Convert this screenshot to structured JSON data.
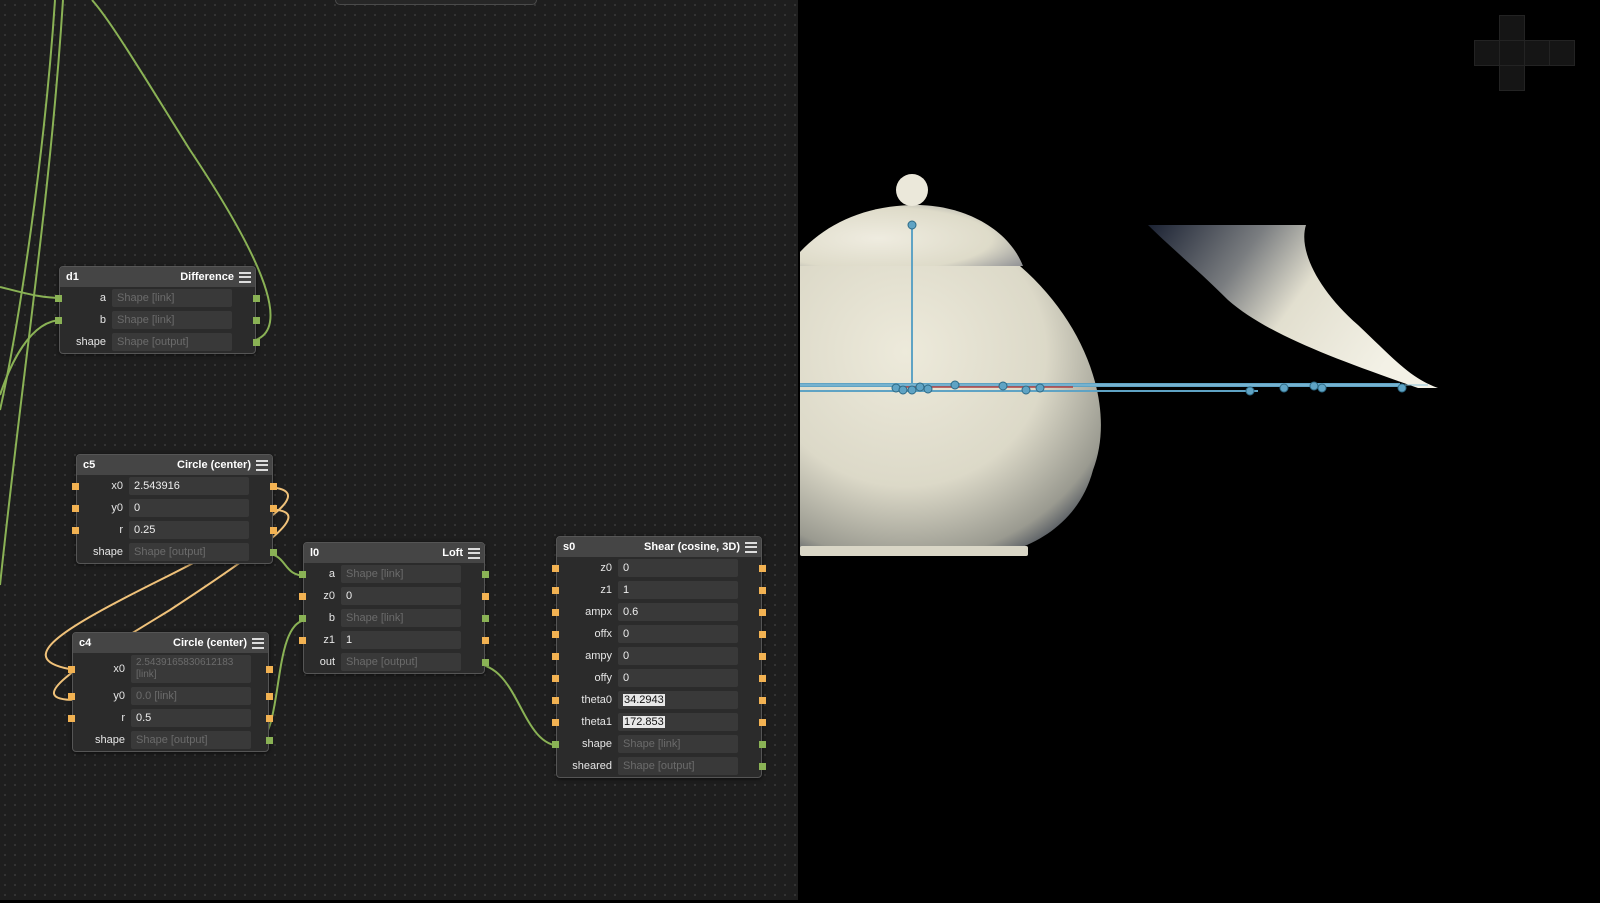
{
  "nodes": {
    "d1": {
      "name": "d1",
      "type": "Difference",
      "rows": [
        {
          "label": "a",
          "value": "Shape [link]"
        },
        {
          "label": "b",
          "value": "Shape [link]"
        },
        {
          "label": "shape",
          "value": "Shape [output]"
        }
      ]
    },
    "c5": {
      "name": "c5",
      "type": "Circle (center)",
      "rows": [
        {
          "label": "x0",
          "value": "2.543916"
        },
        {
          "label": "y0",
          "value": "0"
        },
        {
          "label": "r",
          "value": "0.25"
        },
        {
          "label": "shape",
          "value": "Shape [output]"
        }
      ]
    },
    "c4": {
      "name": "c4",
      "type": "Circle (center)",
      "rows": [
        {
          "label": "x0",
          "value": "2.5439165830612183 [link]"
        },
        {
          "label": "y0",
          "value": "0.0 [link]"
        },
        {
          "label": "r",
          "value": "0.5"
        },
        {
          "label": "shape",
          "value": "Shape [output]"
        }
      ]
    },
    "l0": {
      "name": "l0",
      "type": "Loft",
      "rows": [
        {
          "label": "a",
          "value": "Shape [link]"
        },
        {
          "label": "z0",
          "value": "0"
        },
        {
          "label": "b",
          "value": "Shape [link]"
        },
        {
          "label": "z1",
          "value": "1"
        },
        {
          "label": "out",
          "value": "Shape [output]"
        }
      ]
    },
    "s0": {
      "name": "s0",
      "type": "Shear (cosine, 3D)",
      "rows": [
        {
          "label": "z0",
          "value": "0"
        },
        {
          "label": "z1",
          "value": "1"
        },
        {
          "label": "ampx",
          "value": "0.6"
        },
        {
          "label": "offx",
          "value": "0"
        },
        {
          "label": "ampy",
          "value": "0"
        },
        {
          "label": "offy",
          "value": "0"
        },
        {
          "label": "theta0",
          "value": "34.2943"
        },
        {
          "label": "theta1",
          "value": "172.853"
        },
        {
          "label": "shape",
          "value": "Shape [link]"
        },
        {
          "label": "sheared",
          "value": "Shape [output]"
        }
      ]
    }
  },
  "colors": {
    "graph_bg": "#1e1e1e",
    "number_port": "#f2b252",
    "shape_port": "#8ab255",
    "shape_wire": "#8ab255",
    "number_wire": "#f0c27a",
    "handle_line": "#5fa3c4",
    "model_surface": "#e6e3d4",
    "axis_red": "#b04040"
  },
  "icons": {
    "menu": "hamburger-menu-icon",
    "nav": "view-navigation-cube-icon"
  }
}
